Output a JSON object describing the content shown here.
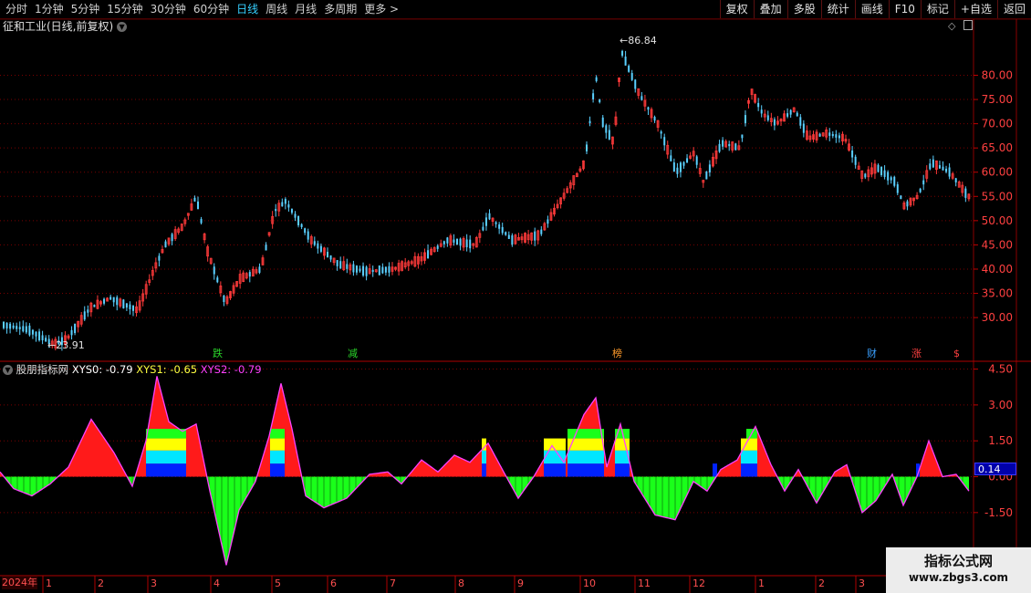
{
  "toolbar": {
    "left": [
      "分时",
      "1分钟",
      "5分钟",
      "15分钟",
      "30分钟",
      "60分钟",
      "日线",
      "周线",
      "月线",
      "多周期",
      "更多 >"
    ],
    "active_period": "日线",
    "right": [
      "复权",
      "叠加",
      "多股",
      "统计",
      "画线",
      "F10",
      "标记",
      "+自选",
      "返回"
    ]
  },
  "main_chart": {
    "title": "征和工业(日线,前复权)",
    "price_axis": [
      "80.00",
      "75.00",
      "70.00",
      "65.00",
      "60.00",
      "55.00",
      "50.00",
      "45.00",
      "40.00",
      "35.00",
      "30.00"
    ],
    "price_range": [
      25.5,
      88
    ],
    "high_label": "86.84",
    "low_label": "23.91",
    "event_markers": [
      {
        "text": "跌",
        "color": "#2ad62a"
      },
      {
        "text": "减",
        "color": "#2ad62a"
      },
      {
        "text": "榜",
        "color": "#ff9a2a"
      },
      {
        "text": "财",
        "color": "#3aa0ff"
      },
      {
        "text": "涨",
        "color": "#ff4040"
      },
      {
        "text": "$",
        "color": "#ff4040"
      }
    ],
    "colors": {
      "up": "#ff3a3a",
      "down": "#5ad0ff",
      "grid": "#7a0000"
    }
  },
  "indicator": {
    "name": "股朋指标网",
    "items": [
      {
        "label": "XYS0: -0.79",
        "color": "#ffffff"
      },
      {
        "label": "XYS1: -0.65",
        "color": "#ffff40"
      },
      {
        "label": "XYS2: -0.79",
        "color": "#ff40ff"
      }
    ],
    "axis": [
      "4.50",
      "3.00",
      "1.50",
      "0.00",
      "-1.50"
    ],
    "axis_values": [
      4.5,
      3.0,
      1.5,
      0.0,
      -1.5
    ],
    "range": [
      -4.1,
      4.75
    ],
    "current_value": "0.14",
    "colors": {
      "positive": "#ff1a1a",
      "negative": "#1aff1a",
      "yellow": "#ffff00",
      "cyan": "#00e6ff",
      "blue": "#0022ff",
      "line": "#ff40ff"
    }
  },
  "time_axis": {
    "year": "2024年",
    "months": [
      "1",
      "2",
      "3",
      "4",
      "5",
      "6",
      "7",
      "8",
      "9",
      "10",
      "11",
      "12",
      "1",
      "2",
      "3"
    ]
  },
  "watermark": {
    "line1": "指标公式网",
    "line2": "www.zbgs3.com"
  }
}
